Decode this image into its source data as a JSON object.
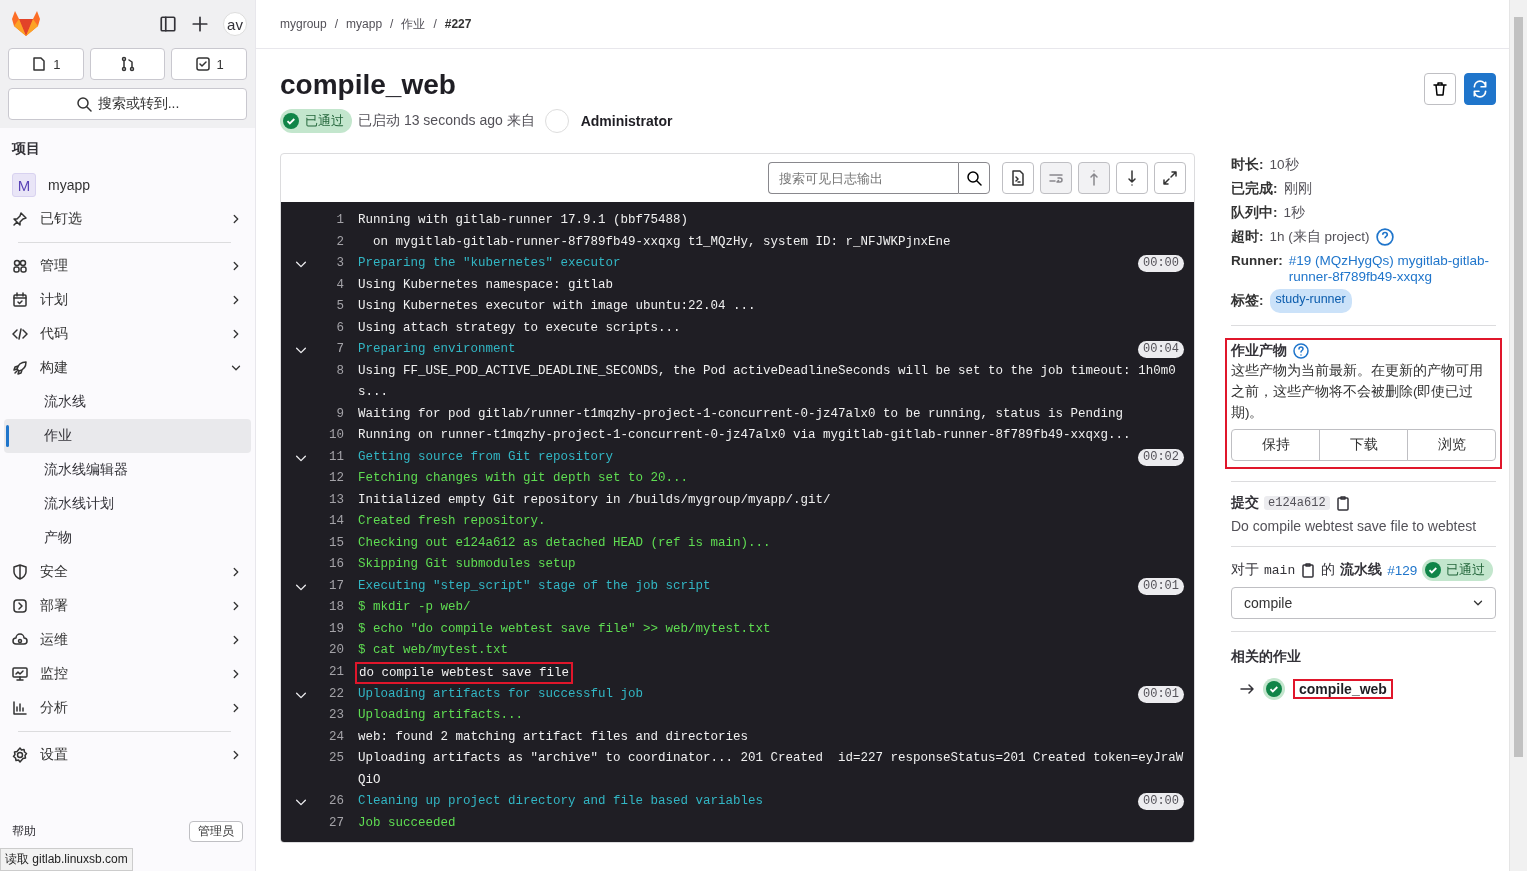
{
  "sidebar": {
    "avatar": "av",
    "counters": [
      {
        "kind": "issues",
        "count": "1"
      },
      {
        "kind": "merges"
      },
      {
        "kind": "todos",
        "count": "1"
      }
    ],
    "search": "搜索或转到...",
    "heading": "项目",
    "project": {
      "initial": "M",
      "name": "myapp"
    },
    "groups": [
      [
        {
          "label": "已钉选",
          "expanded": false
        }
      ],
      [
        {
          "label": "管理",
          "expanded": false
        },
        {
          "label": "计划",
          "expanded": false
        },
        {
          "label": "代码",
          "expanded": false
        },
        {
          "label": "构建",
          "expanded": true,
          "children": [
            {
              "label": "流水线",
              "selected": false
            },
            {
              "label": "作业",
              "selected": true
            },
            {
              "label": "流水线编辑器",
              "selected": false
            },
            {
              "label": "流水线计划",
              "selected": false
            },
            {
              "label": "产物",
              "selected": false
            }
          ]
        },
        {
          "label": "安全",
          "expanded": false
        },
        {
          "label": "部署",
          "expanded": false
        },
        {
          "label": "运维",
          "expanded": false
        },
        {
          "label": "监控",
          "expanded": false
        },
        {
          "label": "分析",
          "expanded": false
        }
      ],
      [
        {
          "label": "设置",
          "expanded": false
        }
      ]
    ],
    "footer": {
      "help": "帮助",
      "admin": "管理员"
    }
  },
  "breadcrumb": {
    "separator": "/",
    "items": [
      "mygroup",
      "myapp",
      "作业",
      "#227"
    ]
  },
  "job": {
    "title": "compile_web",
    "status": "已通过",
    "started": "已启动 13 seconds ago 来自",
    "user": "Administrator"
  },
  "log": {
    "search_placeholder": "搜索可见日志输出",
    "lines": [
      {
        "n": "1",
        "kind": "plain",
        "text": "Running with gitlab-runner 17.9.1 (bbf75488)"
      },
      {
        "n": "2",
        "kind": "plain",
        "text": "  on mygitlab-gitlab-runner-8f789fb49-xxqxg t1_MQzHy, system ID: r_NFJWKPjnxEne"
      },
      {
        "n": "3",
        "kind": "section",
        "text": "Preparing the \"kubernetes\" executor",
        "time": "00:00"
      },
      {
        "n": "4",
        "kind": "plain",
        "text": "Using Kubernetes namespace: gitlab"
      },
      {
        "n": "5",
        "kind": "plain",
        "text": "Using Kubernetes executor with image ubuntu:22.04 ..."
      },
      {
        "n": "6",
        "kind": "plain",
        "text": "Using attach strategy to execute scripts..."
      },
      {
        "n": "7",
        "kind": "section",
        "text": "Preparing environment",
        "time": "00:04"
      },
      {
        "n": "8",
        "kind": "plain",
        "text": "Using FF_USE_POD_ACTIVE_DEADLINE_SECONDS, the Pod activeDeadlineSeconds will be set to the job timeout: 1h0m0s..."
      },
      {
        "n": "9",
        "kind": "plain",
        "text": "Waiting for pod gitlab/runner-t1mqzhy-project-1-concurrent-0-jz47alx0 to be running, status is Pending"
      },
      {
        "n": "10",
        "kind": "plain",
        "text": "Running on runner-t1mqzhy-project-1-concurrent-0-jz47alx0 via mygitlab-gitlab-runner-8f789fb49-xxqxg..."
      },
      {
        "n": "11",
        "kind": "section",
        "text": "Getting source from Git repository",
        "time": "00:02"
      },
      {
        "n": "12",
        "kind": "green",
        "text": "Fetching changes with git depth set to 20..."
      },
      {
        "n": "13",
        "kind": "plain",
        "text": "Initialized empty Git repository in /builds/mygroup/myapp/.git/"
      },
      {
        "n": "14",
        "kind": "green",
        "text": "Created fresh repository."
      },
      {
        "n": "15",
        "kind": "green",
        "text": "Checking out e124a612 as detached HEAD (ref is main)..."
      },
      {
        "n": "16",
        "kind": "green",
        "text": "Skipping Git submodules setup"
      },
      {
        "n": "17",
        "kind": "section",
        "text": "Executing \"step_script\" stage of the job script",
        "time": "00:01"
      },
      {
        "n": "18",
        "kind": "green",
        "text": "$ mkdir -p web/"
      },
      {
        "n": "19",
        "kind": "green",
        "text": "$ echo \"do compile webtest save file\" >> web/mytest.txt"
      },
      {
        "n": "20",
        "kind": "green",
        "text": "$ cat web/mytest.txt"
      },
      {
        "n": "21",
        "kind": "plain",
        "text": "do compile webtest save file",
        "highlighted": true
      },
      {
        "n": "22",
        "kind": "section",
        "text": "Uploading artifacts for successful job",
        "time": "00:01"
      },
      {
        "n": "23",
        "kind": "green",
        "text": "Uploading artifacts..."
      },
      {
        "n": "24",
        "kind": "plain",
        "text": "web: found 2 matching artifact files and directories"
      },
      {
        "n": "25",
        "kind": "plain",
        "text": "Uploading artifacts as \"archive\" to coordinator... 201 Created  id=227 responseStatus=201 Created token=eyJraWQiO"
      },
      {
        "n": "26",
        "kind": "section",
        "text": "Cleaning up project directory and file based variables",
        "time": "00:00"
      },
      {
        "n": "27",
        "kind": "green",
        "text": "Job succeeded"
      }
    ]
  },
  "details": {
    "rows": [
      {
        "label": "时长:",
        "value": "10秒"
      },
      {
        "label": "已完成:",
        "value": "刚刚"
      },
      {
        "label": "队列中:",
        "value": "1秒"
      },
      {
        "label": "超时:",
        "value": "1h (来自 project)",
        "help": true
      }
    ],
    "runner": {
      "label": "Runner:",
      "value": "#19 (MQzHygQs) mygitlab-gitlab-runner-8f789fb49-xxqxg"
    },
    "tags": {
      "label": "标签:",
      "items": [
        "study-runner"
      ]
    }
  },
  "artifacts": {
    "title": "作业产物",
    "text": "这些产物为当前最新。在更新的产物可用之前，这些产物将不会被删除(即使已过期)。",
    "buttons": [
      "保持",
      "下载",
      "浏览"
    ],
    "highlighted": true
  },
  "commit": {
    "label": "提交",
    "sha": "e124a612",
    "message": "Do compile webtest save file to webtest"
  },
  "pipeline": {
    "prefix": "对于",
    "branch": "main",
    "of": "的",
    "label": "流水线",
    "number": "#129",
    "status": "已通过",
    "stage": "compile"
  },
  "related": {
    "title": "相关的作业",
    "jobs": [
      {
        "name": "compile_web",
        "highlighted": true
      }
    ]
  },
  "status_bar": "读取 gitlab.linuxsb.com"
}
